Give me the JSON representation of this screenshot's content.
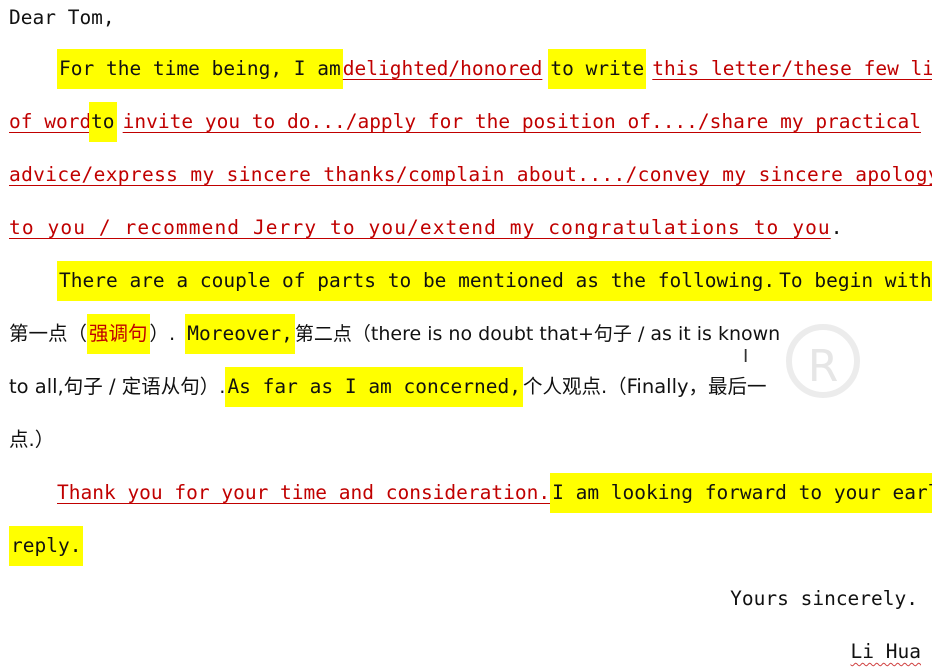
{
  "salutation": "Dear Tom,",
  "p1": {
    "a": "For the time being, I am",
    "b": "delighted/honored",
    "c": "to write",
    "d": "this letter/these few lines",
    "e": "of words",
    "f": "to",
    "g": "invite you to do.../apply for the position of..../share my practical",
    "h": "advice/express my sincere thanks/complain about..../convey my sincere apology",
    "i": "to you / recommend Jerry to you/extend my congratulations to you",
    "j": "."
  },
  "p2": {
    "a": "There are a couple of parts to be mentioned as the following.",
    "b": "To begin with,",
    "c": "第一点（",
    "d": "强调句",
    "e": "）.",
    "f": "Moreover,",
    "g": "第二点（there is no doubt that+句子 / as it is known",
    "h": "to all,句子 / 定语从句）.",
    "i": "As far as I am concerned,",
    "j": "个人观点.（Finally，最后一",
    "k": "点.）"
  },
  "p3": {
    "a": "Thank you for your time and consideration.",
    "b": "I am looking forward to your early",
    "c": "reply."
  },
  "closing": "Yours sincerely.",
  "signature": "Li Hua",
  "cursor_glyph": "I",
  "watermark_glyph": "R",
  "colors": {
    "highlight": "#ffff00",
    "red_text": "#c00000"
  }
}
